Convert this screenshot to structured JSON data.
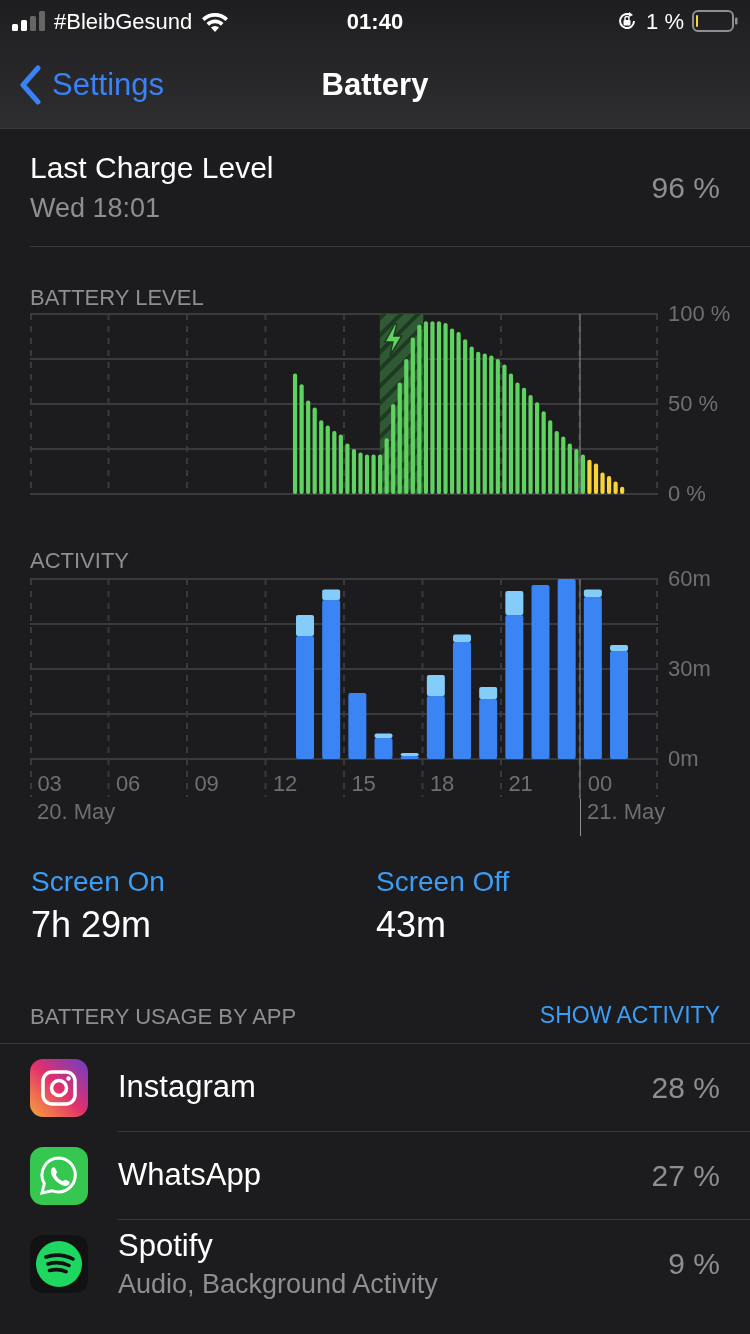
{
  "status_bar": {
    "carrier": "#BleibGesund",
    "time": "01:40",
    "battery_percent": "1 %"
  },
  "nav": {
    "back": "Settings",
    "title": "Battery"
  },
  "last_charge": {
    "title": "Last Charge Level",
    "subtitle": "Wed 18:01",
    "value": "96 %"
  },
  "battery_level": {
    "heading": "BATTERY LEVEL",
    "chart_data": {
      "type": "bar",
      "xlim": [
        2.25,
        26.25
      ],
      "ylim": [
        0,
        100
      ],
      "yticks": [
        {
          "value": 0,
          "label": "0 %"
        },
        {
          "value": 50,
          "label": "50 %"
        },
        {
          "value": 100,
          "label": "100 %"
        }
      ],
      "x": [
        12.38,
        12.63,
        12.88,
        13.13,
        13.38,
        13.63,
        13.88,
        14.13,
        14.38,
        14.63,
        14.88,
        15.13,
        15.38,
        15.63,
        15.88,
        16.13,
        16.38,
        16.63,
        16.88,
        17.13,
        17.38,
        17.63,
        17.88,
        18.13,
        18.38,
        18.63,
        18.88,
        19.13,
        19.38,
        19.63,
        19.88,
        20.13,
        20.38,
        20.63,
        20.88,
        21.13,
        21.38,
        21.63,
        21.88,
        22.13,
        22.38,
        22.63,
        22.88,
        23.13,
        23.38,
        23.63,
        23.88,
        24.13,
        24.38,
        24.63,
        24.88
      ],
      "series": [
        {
          "color": "#5fd35f",
          "values": [
            67,
            61,
            52,
            48,
            41,
            38,
            35,
            33,
            28,
            25,
            23,
            22,
            22,
            22,
            31,
            50,
            62,
            75,
            87,
            94,
            96,
            96,
            96,
            95,
            92,
            90,
            86,
            82,
            79,
            78,
            77,
            75,
            72,
            67,
            62,
            59,
            55,
            51,
            46,
            41,
            35,
            32,
            28,
            25,
            22,
            null,
            null,
            null,
            null,
            null,
            null
          ]
        },
        {
          "color": "#f8d33a",
          "values": [
            null,
            null,
            null,
            null,
            null,
            null,
            null,
            null,
            null,
            null,
            null,
            null,
            null,
            null,
            null,
            null,
            null,
            null,
            null,
            null,
            null,
            null,
            null,
            null,
            null,
            null,
            null,
            null,
            null,
            null,
            null,
            null,
            null,
            null,
            null,
            null,
            null,
            null,
            null,
            null,
            null,
            null,
            null,
            null,
            null,
            19,
            17,
            12,
            10,
            7,
            4
          ]
        }
      ],
      "bands": [
        {
          "axis": "x",
          "from": 15.62,
          "to": 17.27
        }
      ],
      "ref_lines": [
        {
          "axis": "x",
          "value": 23.27
        }
      ]
    }
  },
  "activity": {
    "heading": "ACTIVITY",
    "chart_data": {
      "type": "bar",
      "stacked": true,
      "xlim": [
        2.25,
        26.25
      ],
      "ylim": [
        0,
        60
      ],
      "yticks": [
        {
          "value": 0,
          "label": "0m"
        },
        {
          "value": 30,
          "label": "30m"
        },
        {
          "value": 60,
          "label": "60m"
        }
      ],
      "xticks": [
        {
          "value": 3,
          "label": "03"
        },
        {
          "value": 6,
          "label": "06"
        },
        {
          "value": 9,
          "label": "09"
        },
        {
          "value": 12,
          "label": "12"
        },
        {
          "value": 15,
          "label": "15"
        },
        {
          "value": 18,
          "label": "18"
        },
        {
          "value": 21,
          "label": "21"
        }
      ],
      "x": [
        12.76,
        13.76,
        14.76,
        15.76,
        16.76,
        17.76,
        18.76,
        19.76,
        20.76,
        21.76,
        22.76,
        23.76,
        24.76
      ],
      "series": [
        {
          "color": "#3a84f4",
          "values": [
            41,
            53,
            22,
            7,
            1,
            21,
            39,
            20,
            48,
            58,
            60,
            54,
            36
          ]
        },
        {
          "color": "#84cdfa",
          "values": [
            7,
            3.5,
            0,
            1.5,
            1,
            7,
            2.5,
            4,
            8,
            0,
            0,
            2.5,
            2
          ]
        }
      ],
      "ref_lines": [
        {
          "axis": "x",
          "value": 23.27
        }
      ]
    },
    "midnight_label": "00",
    "date_labels": [
      "20. May",
      "21. May"
    ]
  },
  "screen_times": [
    {
      "label": "Screen On",
      "value": "7h 29m"
    },
    {
      "label": "Screen Off",
      "value": "43m"
    }
  ],
  "usage": {
    "heading": "BATTERY USAGE BY APP",
    "action": "SHOW ACTIVITY",
    "apps": [
      {
        "name": "Instagram",
        "kind": "instagram",
        "percent": "28 %"
      },
      {
        "name": "WhatsApp",
        "kind": "whatsapp",
        "percent": "27 %"
      },
      {
        "name": "Spotify",
        "kind": "spotify",
        "subtitle": "Audio, Background Activity",
        "percent": "9 %"
      }
    ]
  }
}
